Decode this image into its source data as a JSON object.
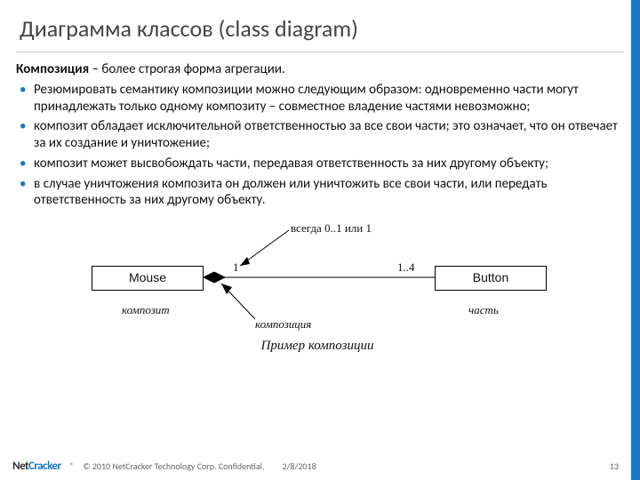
{
  "title": "Диаграмма классов (class diagram)",
  "lead_bold": "Композиция",
  "lead_rest": " – более строгая форма агрегации.",
  "bullets": [
    "Резюмировать семантику композиции можно следующим образом: одновременно части могут принадлежать только одному композиту – совместное владение частями невозможно;",
    "композит обладает исключительной ответственностью за все свои части; это означает, что он отвечает за их создание и уничтожение;",
    "композит может высвобождать части, передавая ответственность за них другому объекту;",
    "в случае уничтожения композита он должен или уничтожить все свои части, или передать ответственность за них другому объекту."
  ],
  "diagram": {
    "box_left": "Mouse",
    "box_right": "Button",
    "annot_top": "всегда 0..1 или 1",
    "mult_left": "1",
    "mult_right": "1..4",
    "label_left": "композит",
    "label_mid": "композиция",
    "label_right": "часть",
    "caption": "Пример композиции"
  },
  "footer": {
    "logo_net": "Net",
    "logo_cracker": "Cracker",
    "reg": "®",
    "copyright": "© 2010 NetCracker Technology Corp. Confidential.",
    "date": "2/8/2018",
    "page": "13"
  }
}
